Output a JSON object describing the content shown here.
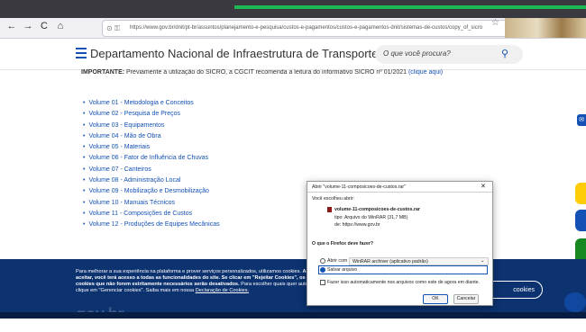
{
  "browser": {
    "url": "https://www.gov.br/dnit/pt-br/assuntos/planejamento-e-pesquisa/custos-e-pagamentos/custos-e-pagamentos-dnit/sistemas-de-custos/copy_of_sicro",
    "back": "←",
    "forward": "→",
    "reload": "C",
    "home": "⌂",
    "bookmark": "☆"
  },
  "header": {
    "title": "Departamento Nacional de Infraestrutura de Transportes",
    "search_placeholder": "O que você procura?",
    "search_icon": "search-icon"
  },
  "notice": {
    "label": "IMPORTANTE:",
    "text": "Previamente à utilização do SICRO, a CGCIT recomenda a leitura do informativo SICRO nº 01/2021",
    "link": "(clique aqui)"
  },
  "volumes": [
    "Volume 01 - Metodologia e Conceitos",
    "Volume 02 - Pesquisa de Preços",
    "Volume 03 - Equipamentos",
    "Volume 04 - Mão de Obra",
    "Volume 05 - Materiais",
    "Volume 06 - Fator de Influência de Chuvas",
    "Volume 07 - Canteiros",
    "Volume 08 - Administração Local",
    "Volume 09 - Mobilização e Desmobilização",
    "Volume 10 - Manuais Técnicos",
    "Volume 11 - Composições de Custos",
    "Volume 12 - Produções de Equipes Mecânicas"
  ],
  "cookie": {
    "text1": "Para melhorar a sua experiência na plataforma e prover serviços personalizados, utilizamos cookies.",
    "bold1": "Ao aceitar, você terá acesso a todas as funcionalidades do site. Se clicar em \"Rejeitar Cookies\", os cookies que não forem estritamente necessários serão desativados.",
    "text2": "Para escolher quais quer autorizar, clique em \"Gerenciar cookies\". Saiba mais em nossa",
    "link": "Declaração de Cookies.",
    "button": "cookies",
    "footer_logo": "gov.br"
  },
  "dialog": {
    "title": "Abrir \"volume-11-composicoes-de-custos.rar\"",
    "close": "✕",
    "chose_label": "Você escolheu abrir:",
    "filename": "volume-11-composicoes-de-custos.rar",
    "type_line": "tipo: Arquivo do WinRAR (31,7 MB)",
    "from_line": "de: https://www.gov.br",
    "question": "O que o Firefox deve fazer?",
    "open_with_label": "Abrir com",
    "open_with_value": "WinRAR archiver (aplicativo padrão)",
    "save_label": "Salvar arquivo",
    "auto_label": "Fazer isso automaticamente nos arquivos como este de agora em diante.",
    "ok": "OK",
    "cancel": "Cancelar",
    "selected_option": "save"
  },
  "colors": {
    "brand_blue": "#1351b4",
    "cookie_bg": "#0c326f",
    "float_yellow": "#ffcd07",
    "float_blue": "#1351b4",
    "float_green": "#168821"
  }
}
